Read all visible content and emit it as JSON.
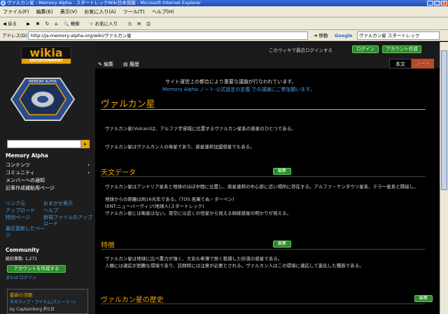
{
  "window": {
    "title": "ヴァルカン星 - Memory Alpha - スタートレックWiki日本語版 - Microsoft Internet Explorer"
  },
  "menu": [
    "ファイル(F)",
    "編集(E)",
    "表示(V)",
    "お気に入り(A)",
    "ツール(T)",
    "ヘルプ(H)"
  ],
  "toolbar": {
    "back": "戻る",
    "search": "検索",
    "favorites": "お気に入り"
  },
  "address": {
    "label": "アドレス(D)",
    "url": "http://ja.memory-alpha.org/wiki/ヴァルカン星",
    "go": "移動",
    "google": "Google",
    "google_query": "ヴァルカン星 スタートレック"
  },
  "sidebar": {
    "logo": "wikia",
    "logo_sub": "ENTERTAINMENT",
    "emblem_text": "MEMORY ALPHA",
    "heading": "Memory Alpha",
    "nav": [
      {
        "label": "コンテンツ",
        "arrow": "›"
      },
      {
        "label": "コミュニティ",
        "arrow": "›"
      },
      {
        "label": "メンバーへの通知"
      },
      {
        "label": "記事作成補助用ページ"
      }
    ],
    "links": [
      {
        "label": "リンク元"
      },
      {
        "label": "おまかせ表示"
      },
      {
        "label": "アップロード"
      },
      {
        "label": "ヘルプ"
      },
      {
        "label": "特別ページ"
      },
      {
        "label": "新規ファイルのアップロード"
      },
      {
        "label": "最近更新したページ"
      }
    ],
    "community": {
      "heading": "Community",
      "wikis": "総記事数: 1,271",
      "button": "アカウントを作成する",
      "login": "または ログイン"
    },
    "activity": {
      "title": "最新の活動",
      "item": "ネガティブ・アイテム(ストーリー)",
      "by": "by Captainborg 約1日"
    }
  },
  "main": {
    "userlinks": "このウィキで最近ログインする",
    "login_btn": "ログイン",
    "create_btn": "アカウント作成",
    "actions": [
      "編集",
      "履歴"
    ],
    "tabs": [
      "本文",
      "ノート"
    ],
    "notice_line1": "サイト運営上の都合により重要な議論が行なわれています。",
    "notice_line2": "Memory Alpha:ノート:公式設定の定義 での議論にご参加願います。",
    "title": "ヴァルカン星",
    "intro1": "ヴァルカン星(Vulcan)は、アルファ宇宙域に位置するヴァルカン星系の惑星のひとつである。",
    "intro2": "ヴァルカン星はヴァルカン人の母星であり、惑星連邦加盟惑星でもある。",
    "sections": [
      {
        "heading": "天文データ",
        "edit": "編集"
      },
      {
        "heading": "特徴",
        "edit": "編集"
      },
      {
        "heading": "ヴァルカン星の歴史",
        "edit": "編集"
      }
    ],
    "astro1": "ヴァルカン星はアンドリア星系と地球のほぼ中間に位置し、惑星連邦の中心部に近い場所に存在する。アルファ・ケンタウリ星系、テラー星系と隣接し、",
    "astro2": "地球からの距離は約16光年である。(TOS:見果てぬ・ターペン)",
    "astro3": "(ENT:ニューバーヴィジ(地球人)スタートレック)",
    "astro4": "ヴァルカン星には衛星はない。夜空には近くの恒星から見える姉妹惑星の明かりが見える。",
    "feature1": "ヴァルカン星は地球に比べ重力が強く、大気も希薄で熱く乾燥した砂漠の惑星である。",
    "feature2": "人類には適応が困難な環境であり、訪問時には注意が必要とされる。ヴァルカン人はこの環境に適応して進化した種族である。"
  }
}
